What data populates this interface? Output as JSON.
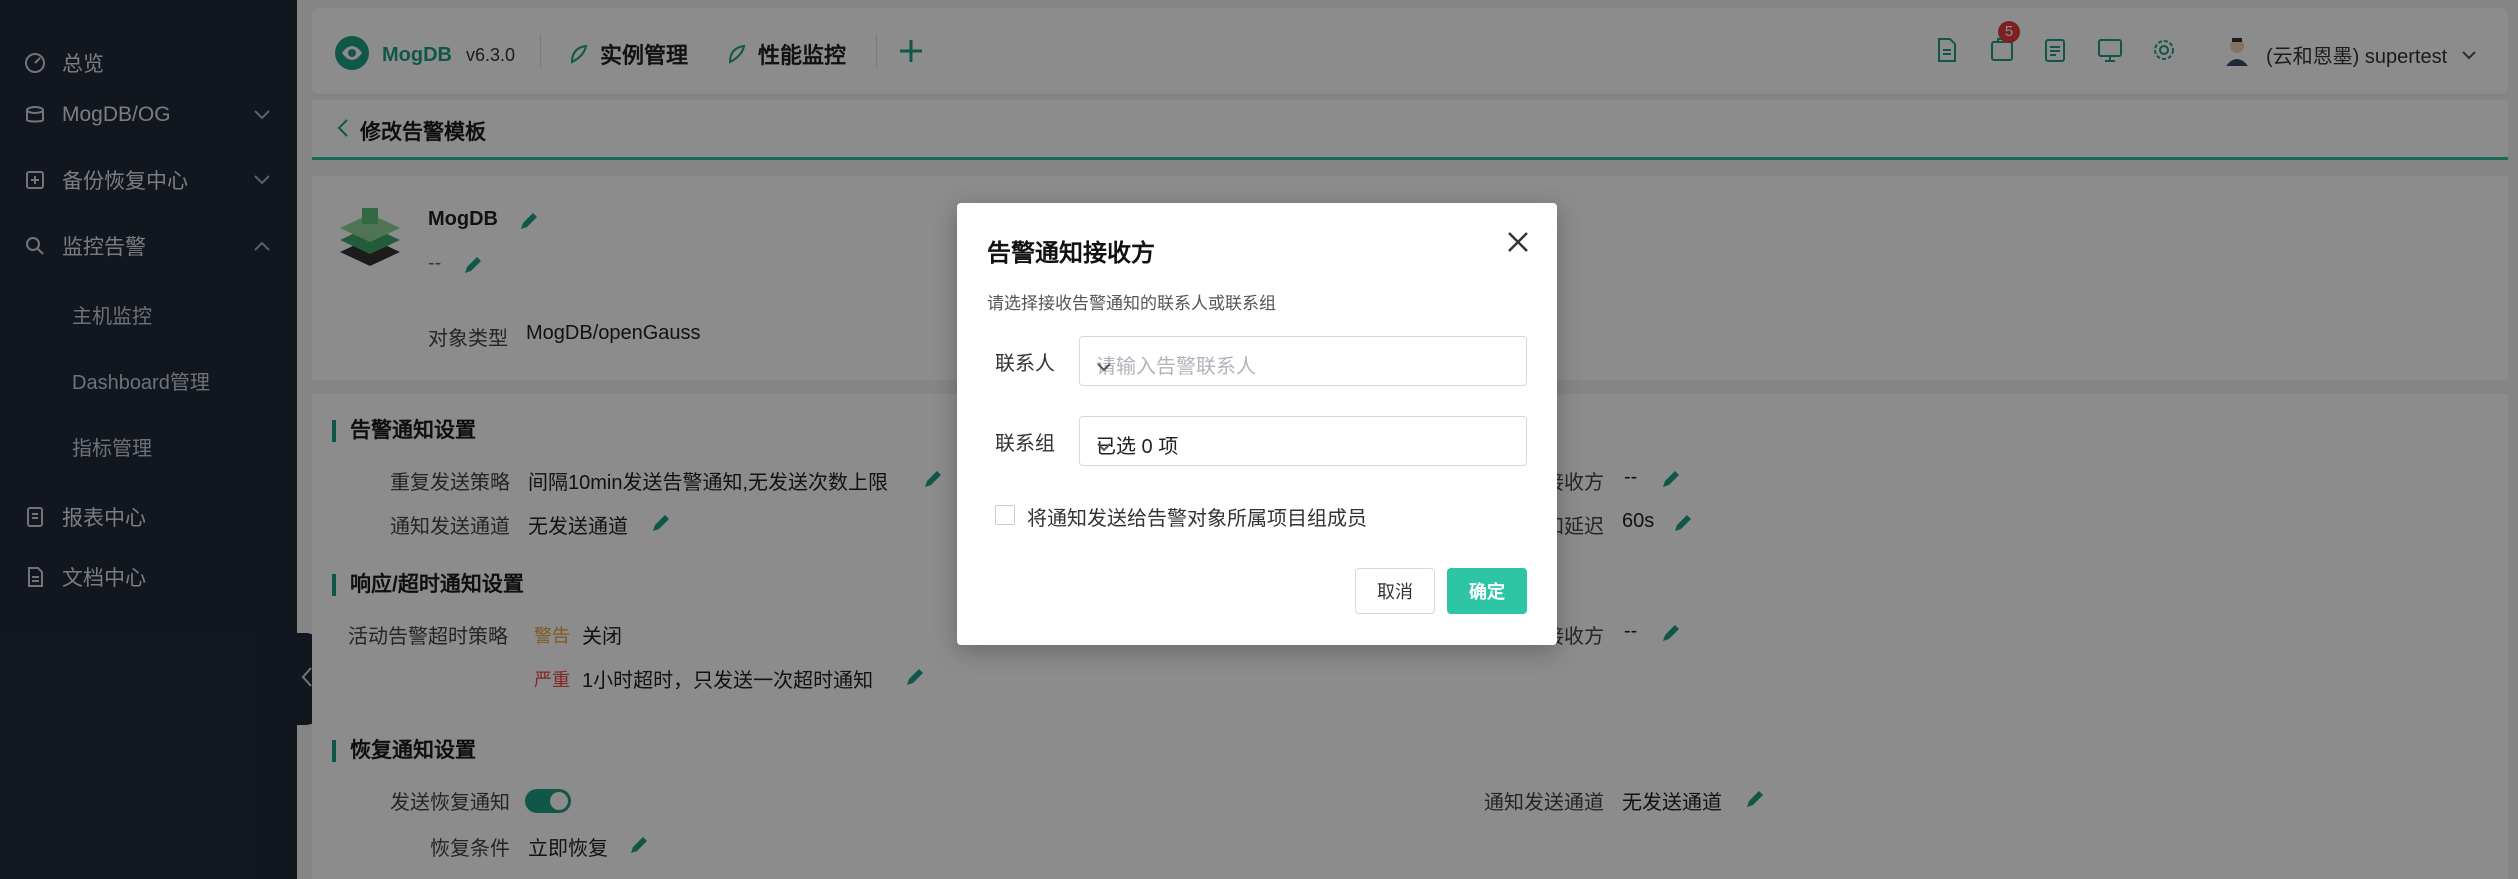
{
  "sidebar": {
    "items": [
      {
        "label": "总览",
        "icon": "dashboard-icon"
      },
      {
        "label": "MogDB/OG",
        "icon": "database-icon"
      },
      {
        "label": "备份恢复中心",
        "icon": "backup-icon"
      },
      {
        "label": "监控告警",
        "icon": "monitor-icon"
      },
      {
        "label": "报表中心",
        "icon": "report-icon"
      },
      {
        "label": "文档中心",
        "icon": "document-icon"
      }
    ],
    "sub_items": [
      "主机监控",
      "Dashboard管理",
      "指标管理"
    ]
  },
  "header": {
    "logo_text": "MogDB",
    "version": "v6.3.0",
    "nav": [
      "实例管理",
      "性能监控"
    ],
    "add_icon": "plus-icon",
    "notification_count": "5",
    "user": "(云和恩墨) supertest"
  },
  "breadcrumb": {
    "title": "修改告警模板"
  },
  "object": {
    "name": "MogDB",
    "desc": "--",
    "type_label": "对象类型",
    "type_value": "MogDB/openGauss"
  },
  "alert_notify": {
    "title": "告警通知设置",
    "repeat_label": "重复发送策略",
    "repeat_value": "间隔10min发送告警通知,无发送次数上限",
    "channel_label": "通知发送通道",
    "channel_value": "无发送通道",
    "receiver_suffix": "接收方",
    "receiver_value": "--",
    "delay_suffix": "知延迟",
    "delay_value": "60s"
  },
  "timeout_notify": {
    "title": "响应/超时通知设置",
    "policy_label": "活动告警超时策略",
    "warn_tag": "警告",
    "warn_value": "关闭",
    "severe_tag": "严重",
    "severe_value": "1小时超时，只发送一次超时通知",
    "receiver_suffix": "接收方",
    "receiver_value": "--"
  },
  "recovery_notify": {
    "title": "恢复通知设置",
    "send_label": "发送恢复通知",
    "send_enabled": true,
    "condition_label": "恢复条件",
    "condition_value": "立即恢复",
    "channel_label": "通知发送通道",
    "channel_value": "无发送通道"
  },
  "modal": {
    "title": "告警通知接收方",
    "description": "请选择接收告警通知的联系人或联系组",
    "contact_label": "联系人",
    "contact_placeholder": "请输入告警联系人",
    "group_label": "联系组",
    "group_value": "已选 0 项",
    "checkbox_label": "将通知发送给告警对象所属项目组成员",
    "cancel": "取消",
    "confirm": "确定"
  },
  "colors": {
    "accent": "#1e9e86",
    "sidebar_bg": "#222a3a",
    "confirm_btn": "#2ec5a6"
  }
}
